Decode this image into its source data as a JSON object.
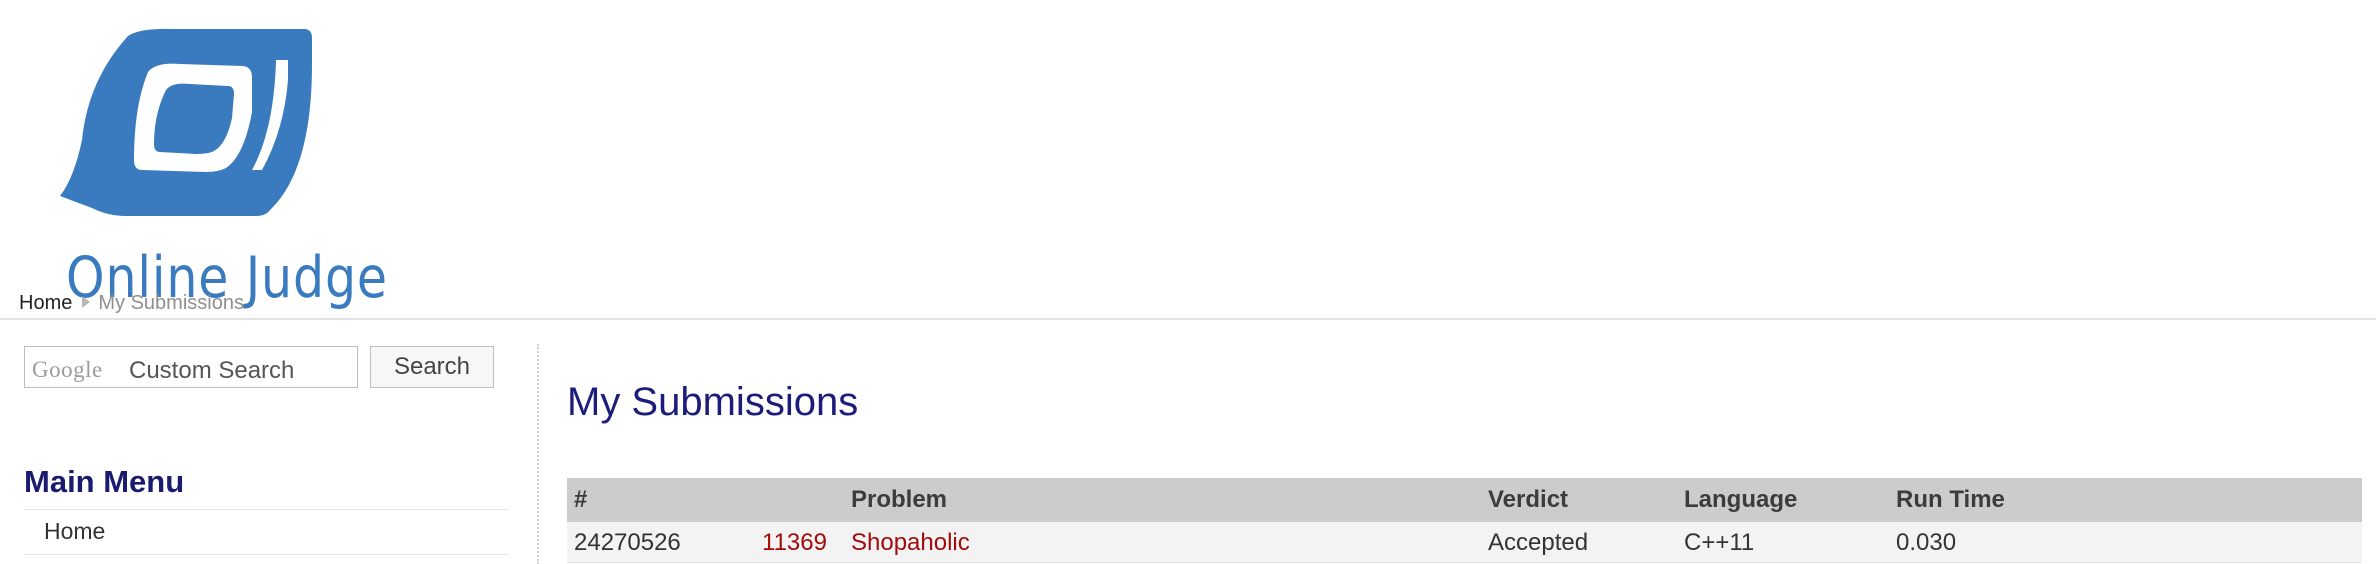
{
  "header": {
    "logo_text": "Online Judge",
    "brand_color": "#3a7bbf"
  },
  "breadcrumb": {
    "home": "Home",
    "current": "My Submissions"
  },
  "sidebar": {
    "search": {
      "google_mark": "Google",
      "placeholder": "Custom Search",
      "button_label": "Search"
    },
    "menu_title": "Main Menu",
    "menu_items": [
      {
        "label": "Home"
      }
    ]
  },
  "main": {
    "title": "My Submissions",
    "table": {
      "columns": {
        "id": "#",
        "problem": "Problem",
        "verdict": "Verdict",
        "language": "Language",
        "runtime": "Run Time"
      },
      "rows": [
        {
          "id": "24270526",
          "problem_number": "11369",
          "problem_name": "Shopaholic",
          "verdict": "Accepted",
          "language": "C++11",
          "runtime": "0.030"
        }
      ]
    }
  },
  "colors": {
    "accent_red": "#a00c0c",
    "title_navy": "#1c1c7a",
    "header_gray": "#cccccc"
  }
}
